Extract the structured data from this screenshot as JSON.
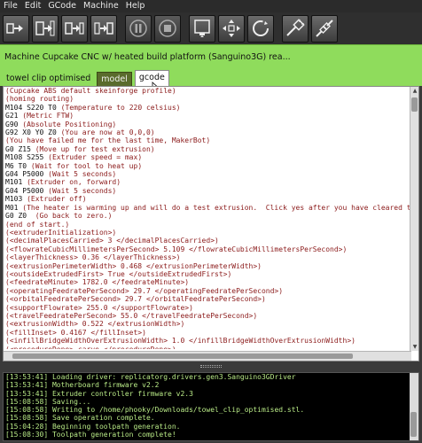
{
  "menu": [
    "File",
    "Edit",
    "GCode",
    "Machine",
    "Help"
  ],
  "toolbar": {
    "buttons": [
      "build-icon",
      "upload-build-icon",
      "build-to-file-icon",
      "build-from-file-icon",
      "pause-icon",
      "stop-icon",
      "extruder-control-icon",
      "jog-icon",
      "reset-icon",
      "connect-icon",
      "disconnect-icon"
    ]
  },
  "status_text": "Machine Cupcake CNC w/ heated build platform (Sanguino3G) rea...",
  "tabs": [
    {
      "label": "towel clip optimised",
      "style": "plain"
    },
    {
      "label": "model",
      "style": "model"
    },
    {
      "label": "gcode",
      "style": "active"
    }
  ],
  "gcode_lines": [
    {
      "code": "",
      "comment": "(Cupcake ABS default skeinforge profile)"
    },
    {
      "code": "",
      "comment": "(homing routing)"
    },
    {
      "code": "M104 S220 T0 ",
      "comment": "(Temperature to 220 celsius)"
    },
    {
      "code": "G21 ",
      "comment": "(Metric FTW)"
    },
    {
      "code": "G90 ",
      "comment": "(Absolute Positioning)"
    },
    {
      "code": "G92 X0 Y0 Z0 ",
      "comment": "(You are now at 0,0,0)"
    },
    {
      "code": "",
      "comment": "(You have failed me for the last time, MakerBot)"
    },
    {
      "code": "G0 Z15 ",
      "comment": "(Move up for test extrusion)"
    },
    {
      "code": "M108 S255 ",
      "comment": "(Extruder speed = max)"
    },
    {
      "code": "M6 T0 ",
      "comment": "(Wait for tool to heat up)"
    },
    {
      "code": "G04 P5000 ",
      "comment": "(Wait 5 seconds)"
    },
    {
      "code": "M101 ",
      "comment": "(Extruder on, forward)"
    },
    {
      "code": "G04 P5000 ",
      "comment": "(Wait 5 seconds)"
    },
    {
      "code": "M103 ",
      "comment": "(Extruder off)"
    },
    {
      "code": "M01 ",
      "comment": "(The heater is warming up and will do a test extrusion.  Click yes after you have cleared th"
    },
    {
      "code": "G0 Z0  ",
      "comment": "(Go back to zero.)"
    },
    {
      "code": "",
      "comment": "(end of start.)"
    },
    {
      "code": "",
      "comment": "(<extruderInitialization>)"
    },
    {
      "code": "",
      "comment": "(<decimalPlacesCarried> 3 </decimalPlacesCarried>)"
    },
    {
      "code": "",
      "comment": "(<flowrateCubicMillimetersPerSecond> 5.109 </flowrateCubicMillimetersPerSecond>)"
    },
    {
      "code": "",
      "comment": "(<layerThickness> 0.36 </layerThickness>)"
    },
    {
      "code": "",
      "comment": "(<extrusionPerimeterWidth> 0.468 </extrusionPerimeterWidth>)"
    },
    {
      "code": "",
      "comment": "(<outsideExtrudedFirst> True </outsideExtrudedFirst>)"
    },
    {
      "code": "",
      "comment": "(<feedrateMinute> 1782.0 </feedrateMinute>)"
    },
    {
      "code": "",
      "comment": "(<operatingFeedratePerSecond> 29.7 </operatingFeedratePerSecond>)"
    },
    {
      "code": "",
      "comment": "(<orbitalFeedratePerSecond> 29.7 </orbitalFeedratePerSecond>)"
    },
    {
      "code": "",
      "comment": "(<supportFlowrate> 255.0 </supportFlowrate>)"
    },
    {
      "code": "",
      "comment": "(<travelFeedratePerSecond> 55.0 </travelFeedratePerSecond>)"
    },
    {
      "code": "",
      "comment": "(<extrusionWidth> 0.522 </extrusionWidth>)"
    },
    {
      "code": "",
      "comment": "(<fillInset> 0.4167 </fillInset>)"
    },
    {
      "code": "",
      "comment": "(<infillBridgeWidthOverExtrusionWidth> 1.0 </infillBridgeWidthOverExtrusionWidth>)"
    },
    {
      "code": "",
      "comment": "(<procedureDone> carve </procedureDone>)"
    }
  ],
  "console_lines": [
    {
      "time": "[13:53:41]",
      "text": " Loading driver: replicatorg.drivers.gen3.Sanguino3GDriver"
    },
    {
      "time": "[13:53:41]",
      "text": " Motherboard firmware v2.2"
    },
    {
      "time": "[13:53:41]",
      "text": " Extruder controller firmware v2.3"
    },
    {
      "time": "[15:08:58]",
      "text": " Saving..."
    },
    {
      "time": "[15:08:58]",
      "text": " Writing to /home/phooky/Downloads/towel_clip_optimised.stl."
    },
    {
      "time": "[15:08:58]",
      "text": " Save operation complete."
    },
    {
      "time": "[15:04:28]",
      "text": " Beginning toolpath generation."
    },
    {
      "time": "[15:08:30]",
      "text": " Toolpath generation complete!"
    }
  ],
  "colors": {
    "status_bg": "#8fdc5c",
    "comment": "#8b1a1a",
    "console_text": "#b8e986",
    "console_bg": "#000000"
  }
}
